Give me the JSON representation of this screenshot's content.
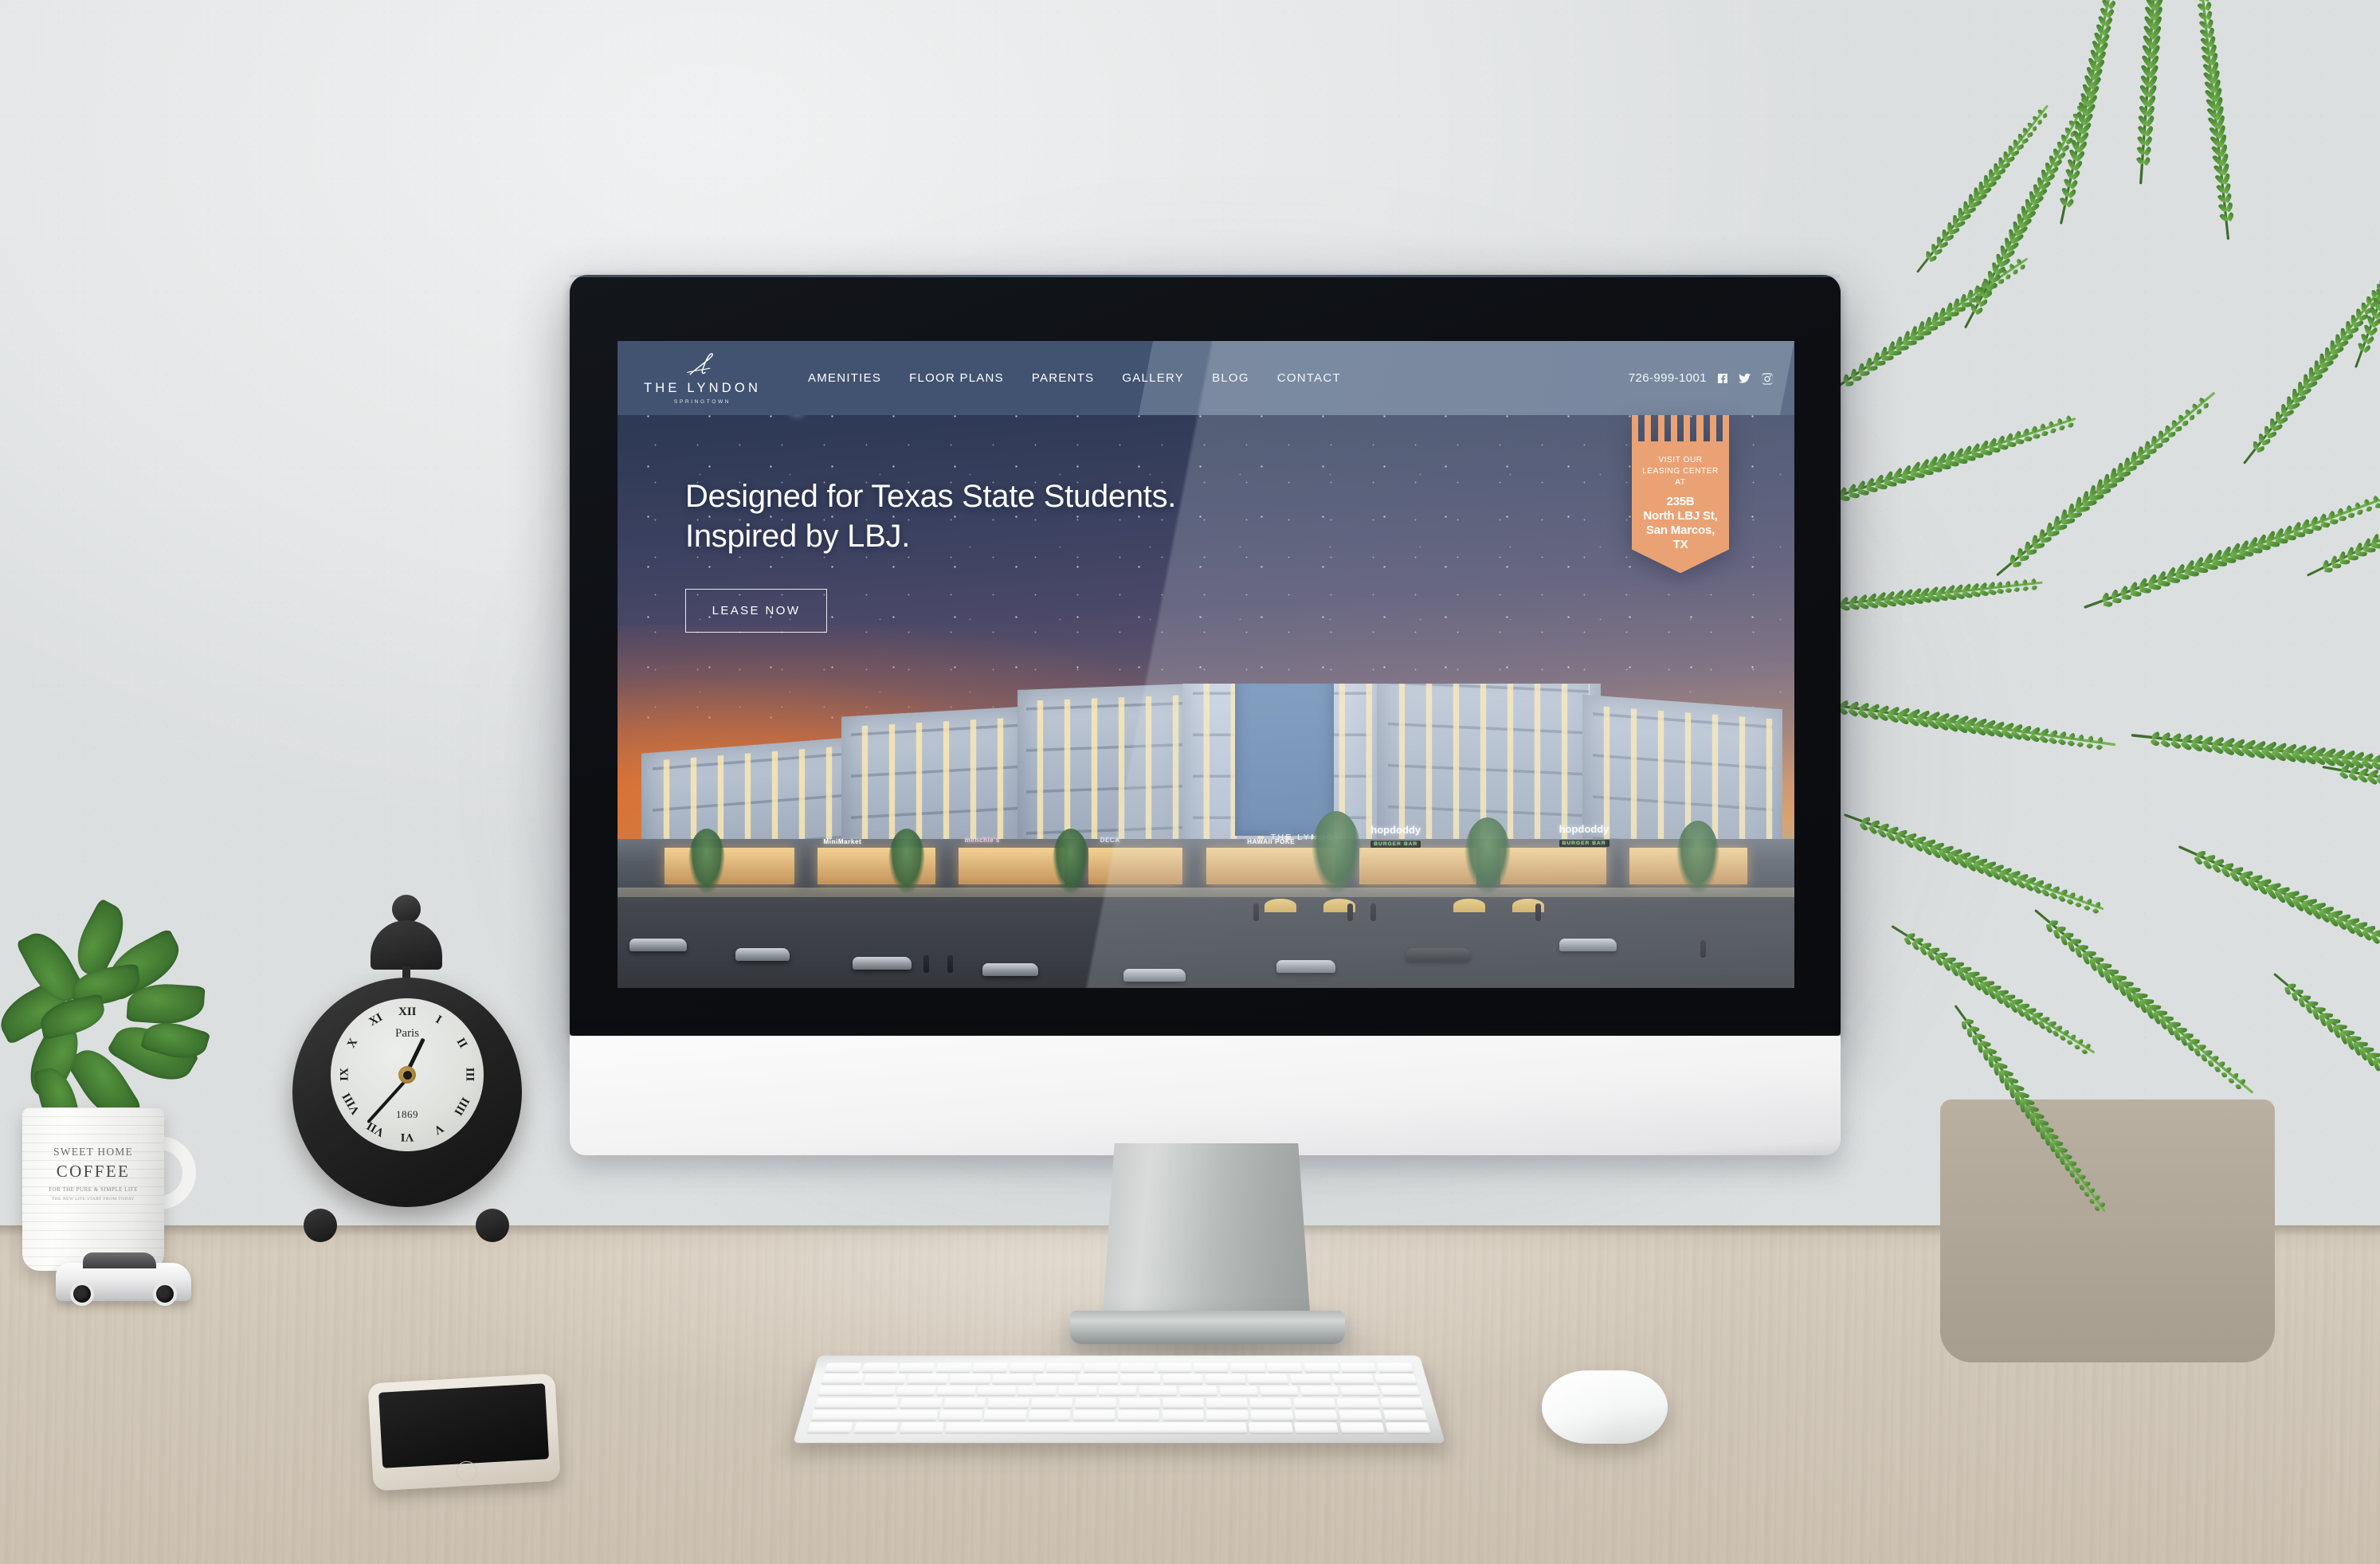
{
  "scene": {
    "description": "Desktop mockup: iMac on a wooden desk showing The Lyndon Springtown apartment website"
  },
  "site": {
    "logo": {
      "name": "THE LYNDON",
      "subtitle": "SPRINGTOWN",
      "mark": "script-l-monogram-icon"
    },
    "nav": {
      "links": [
        {
          "label": "AMENITIES",
          "name": "nav-link-amenities"
        },
        {
          "label": "FLOOR PLANS",
          "name": "nav-link-floor-plans"
        },
        {
          "label": "PARENTS",
          "name": "nav-link-parents"
        },
        {
          "label": "GALLERY",
          "name": "nav-link-gallery"
        },
        {
          "label": "BLOG",
          "name": "nav-link-blog"
        },
        {
          "label": "CONTACT",
          "name": "nav-link-contact"
        }
      ],
      "phone": "726-999-1001",
      "social": [
        "facebook-icon",
        "twitter-icon",
        "instagram-icon"
      ]
    },
    "hero": {
      "headline_line1": "Designed for Texas State Students.",
      "headline_line2": "Inspired by LBJ.",
      "cta": "LEASE NOW"
    },
    "badge": {
      "line1": "VISIT OUR",
      "line2": "LEASING CENTER AT",
      "address_line1": "235B",
      "address_line2": "North LBJ St,",
      "address_line3": "San Marcos, TX"
    },
    "rendering": {
      "building_sign": "THE LYNDON",
      "storefronts": [
        "MiniMarket",
        "menchie's",
        "DECA",
        "HAWAII POKE"
      ],
      "restaurant": {
        "name": "hopdoddy",
        "tagline": "BURGER BAR"
      }
    },
    "colors": {
      "nav_blue": "#415370",
      "badge_orange": "#eaa274",
      "text_white": "#ffffff",
      "sky_dark": "#2b3550",
      "sunset_orange": "#e9732d"
    }
  },
  "desk": {
    "clock": {
      "brand": "Paris",
      "year": "1869",
      "numerals": [
        "XII",
        "I",
        "II",
        "III",
        "IIII",
        "V",
        "VI",
        "VII",
        "VIII",
        "IX",
        "X",
        "XI"
      ]
    },
    "mug": {
      "line1": "SWEET HOME",
      "line2": "COFFEE",
      "line3": "FOR THE PURE & SIMPLE LIFE",
      "line4": "THE NEW LIFE START FROM TODAY"
    },
    "items": [
      "coffee-plant",
      "coffee-mug",
      "toy-car",
      "alarm-clock",
      "smartphone",
      "keyboard",
      "mouse",
      "fern-plant"
    ]
  }
}
